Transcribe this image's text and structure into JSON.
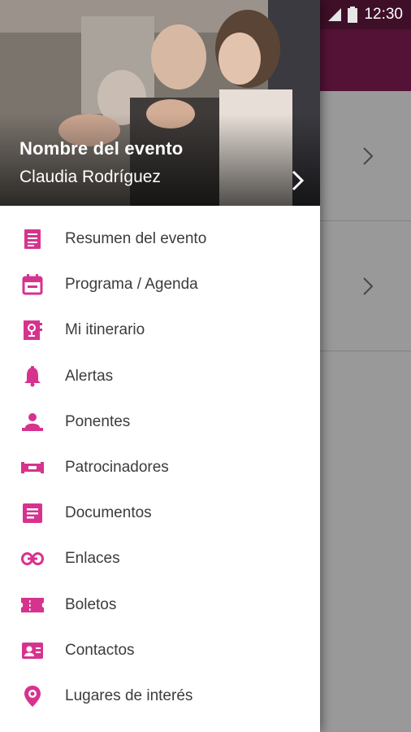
{
  "status_bar": {
    "time": "12:30"
  },
  "drawer": {
    "event_name": "Nombre del evento",
    "user_name": "Claudia Rodríguez",
    "accent_color": "#d6338f",
    "menu": [
      {
        "label": "Resumen del evento",
        "icon": "document-list-icon"
      },
      {
        "label": "Programa / Agenda",
        "icon": "calendar-icon"
      },
      {
        "label": "Mi itinerario",
        "icon": "itinerary-book-icon"
      },
      {
        "label": "Alertas",
        "icon": "bell-icon"
      },
      {
        "label": "Ponentes",
        "icon": "speaker-podium-icon"
      },
      {
        "label": "Patrocinadores",
        "icon": "sponsor-banner-icon"
      },
      {
        "label": "Documentos",
        "icon": "document-icon"
      },
      {
        "label": "Enlaces",
        "icon": "link-icon"
      },
      {
        "label": "Boletos",
        "icon": "ticket-icon"
      },
      {
        "label": "Contactos",
        "icon": "contact-card-icon"
      },
      {
        "label": "Lugares de interés",
        "icon": "map-pin-icon"
      }
    ]
  }
}
